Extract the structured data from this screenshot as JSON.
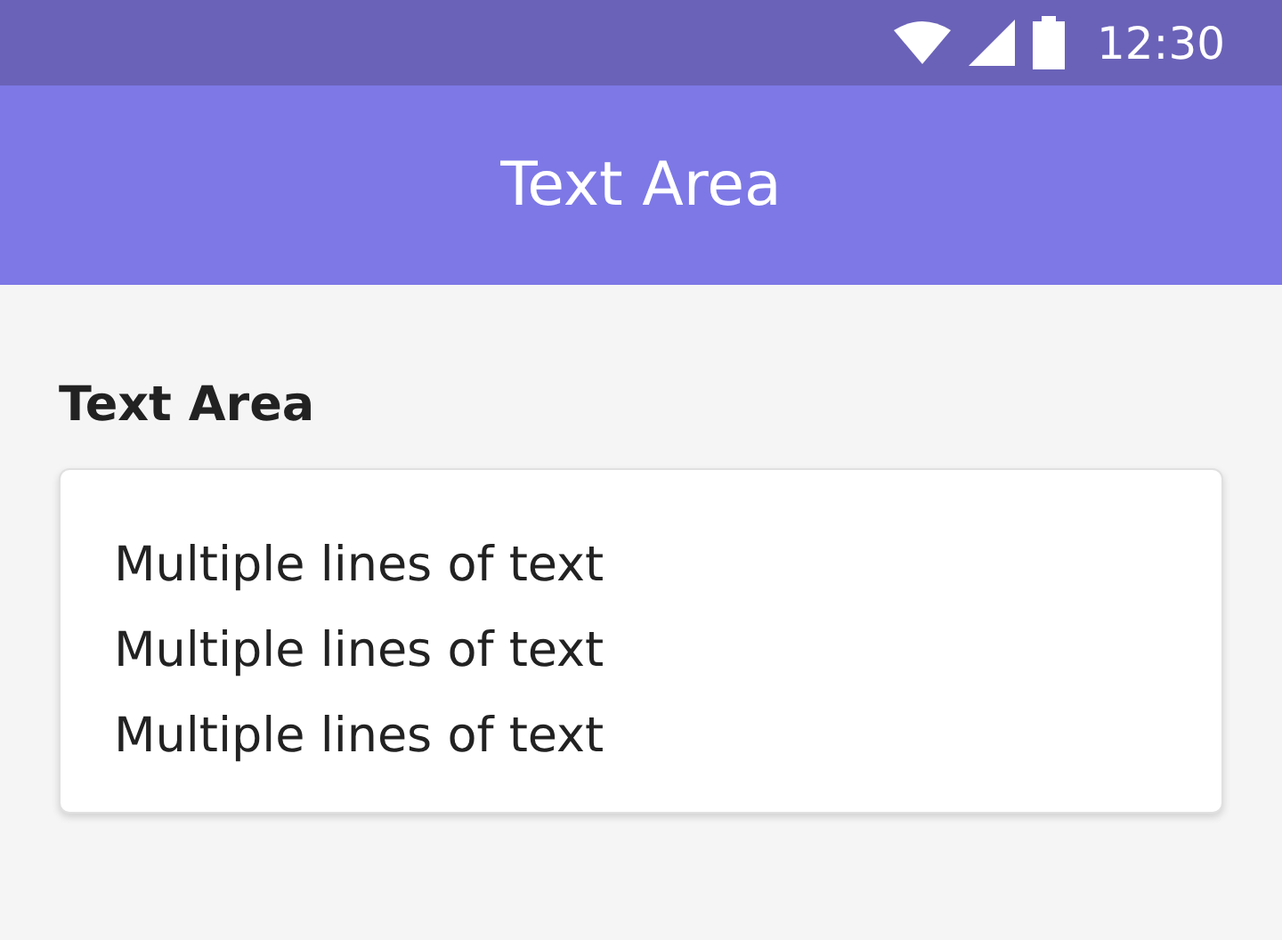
{
  "status_bar": {
    "time": "12:30"
  },
  "app_bar": {
    "title": "Text Area"
  },
  "text_area": {
    "label": "Text Area",
    "value": "Multiple lines of text\nMultiple lines of text\nMultiple lines of text"
  }
}
